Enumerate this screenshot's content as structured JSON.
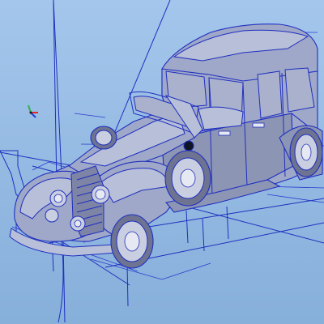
{
  "viewport": {
    "background_top": "#a4c6ec",
    "background_bottom": "#86afda",
    "wireframe_color": "#1f2fbf",
    "model_shade": "#9fa8c8"
  },
  "model": {
    "subject": "classic-sedan-car-model",
    "display_mode": "shaded-with-edges"
  },
  "triad": {
    "axes": [
      {
        "axis": "x",
        "color": "#e8261f"
      },
      {
        "axis": "y",
        "color": "#2fb34a"
      },
      {
        "axis": "z",
        "color": "#1f3fd6"
      }
    ]
  }
}
